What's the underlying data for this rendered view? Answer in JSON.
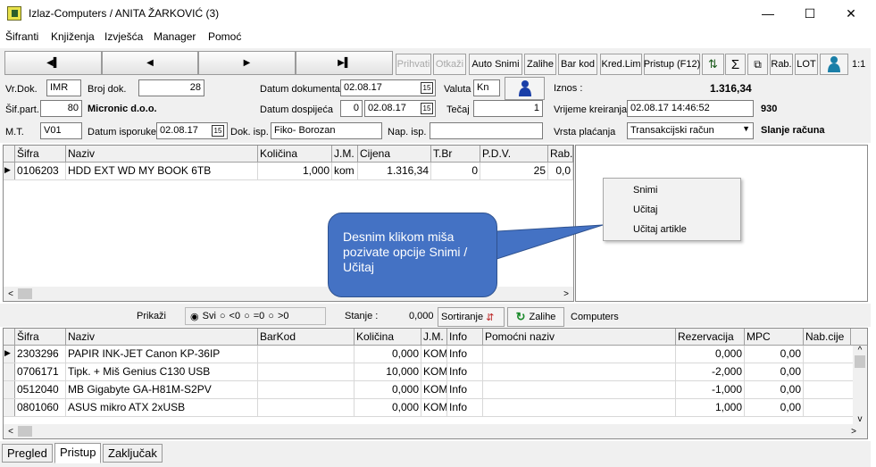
{
  "window": {
    "title": "Izlaz-Computers / ANITA ŽARKOVIĆ (3)",
    "minimize": "—",
    "maximize": "☐",
    "close": "✕"
  },
  "menu": [
    "Šifranti",
    "Knjiženja",
    "Izvješća",
    "Manager",
    "Pomoć"
  ],
  "nav": {
    "first": "◀▌",
    "prev": "◀",
    "next": "▶",
    "last": "▶▌"
  },
  "toolbar": {
    "prihvati": "Prihvati",
    "otkazi": "Otkaži",
    "auto_snimi": "Auto Snimi",
    "zalihe": "Zalihe",
    "bar_kod": "Bar kod",
    "kred_lim": "Kred.Lim",
    "pristup": "Pristup (F12)",
    "sigma": "Σ",
    "rab": "Rab.",
    "lot": "LOT",
    "ratio": "1:1"
  },
  "header": {
    "vr_dok_label": "Vr.Dok.",
    "vr_dok": "IMR",
    "broj_dok_label": "Broj dok.",
    "broj_dok": "28",
    "datum_dok_label": "Datum dokumenta",
    "datum_dok": "02.08.17",
    "valuta_label": "Valuta",
    "valuta": "Kn",
    "iznos_label": "Iznos :",
    "iznos": "1.316,34",
    "sif_part_label": "Šif.part.",
    "sif_part": "80",
    "partner": "Micronic d.o.o.",
    "datum_dosp_label": "Datum dospijeća",
    "dosp_days": "0",
    "datum_dosp": "02.08.17",
    "tecaj_label": "Tečaj",
    "tecaj": "1",
    "vrijeme_label": "Vrijeme kreiranja",
    "vrijeme": "02.08.17 14:46:52",
    "vrijeme_num": "930",
    "mt_label": "M.T.",
    "mt": "V01",
    "datum_isp_label": "Datum isporuke",
    "datum_isp": "02.08.17",
    "dok_isp_label": "Dok. isp.",
    "dok_isp": "Fiko- Borozan",
    "nap_isp_label": "Nap. isp.",
    "nap_isp": "",
    "vrsta_label": "Vrsta plaćanja",
    "vrsta": "Transakcijski račun",
    "slanje": "Slanje računa"
  },
  "items_grid": {
    "columns": [
      "Šifra",
      "Naziv",
      "Količina",
      "J.M.",
      "Cijena",
      "T.Br",
      "P.D.V.",
      "Rab."
    ],
    "rows": [
      [
        "0106203",
        "HDD EXT WD MY BOOK 6TB",
        "1,000",
        "kom",
        "1.316,34",
        "0",
        "25",
        "0,0"
      ]
    ]
  },
  "context_menu": [
    "Snimi",
    "Učitaj",
    "Učitaj artikle"
  ],
  "callout": "Desnim klikom miša pozivate opcije Snimi / Učitaj",
  "filter": {
    "prikazi": "Prikaži",
    "opts": [
      "Svi",
      "<0",
      "=0",
      ">0"
    ],
    "stanje_label": "Stanje :",
    "stanje": "0,000",
    "sortiranje": "Sortiranje",
    "zalihe": "Zalihe",
    "computers": "Computers"
  },
  "stock_grid": {
    "columns": [
      "Šifra",
      "Naziv",
      "BarKod",
      "Količina",
      "J.M.",
      "Info",
      "Pomoćni naziv",
      "Rezervacija",
      "MPC",
      "Nab.cije"
    ],
    "rows": [
      [
        "2303296",
        "PAPIR INK-JET Canon KP-36IP",
        "",
        "0,000",
        "KOM",
        "Info",
        "",
        "0,000",
        "0,00"
      ],
      [
        "0706171",
        "Tipk. + Miš Genius C130 USB",
        "",
        "10,000",
        "KOM",
        "Info",
        "",
        "-2,000",
        "0,00"
      ],
      [
        "0512040",
        "MB Gigabyte GA-H81M-S2PV",
        "",
        "0,000",
        "KOM",
        "Info",
        "",
        "-1,000",
        "0,00"
      ],
      [
        "0801060",
        " ASUS mikro ATX 2xUSB",
        "",
        "0,000",
        "KOM",
        "Info",
        "",
        "1,000",
        "0,00"
      ]
    ]
  },
  "tabs": [
    "Pregled",
    "Pristup",
    "Zaključak"
  ]
}
